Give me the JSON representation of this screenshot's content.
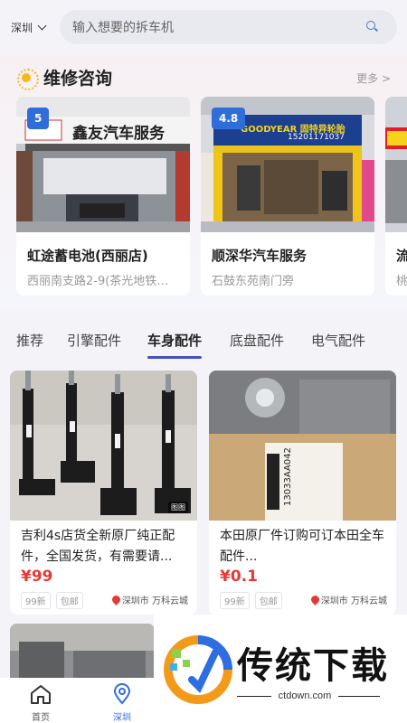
{
  "header": {
    "city": "深圳",
    "search_placeholder": "输入想要的拆车机"
  },
  "repair": {
    "title": "维修咨询",
    "more": "更多 >",
    "shops": [
      {
        "rating": "5",
        "name": "虹途蓄电池(西丽店)",
        "address": "西丽南支路2-9(茶光地铁…",
        "sign": "鑫友汽车服务"
      },
      {
        "rating": "4.8",
        "name": "顺深华汽车服务",
        "address": "石鼓东苑南门旁",
        "sign": "GOODYEAR 固特异轮胎",
        "phone": "15201171037"
      },
      {
        "rating": "",
        "name": "流",
        "address": "桃"
      }
    ]
  },
  "tabs": [
    "推荐",
    "引擎配件",
    "车身配件",
    "底盘配件",
    "电气配件"
  ],
  "active_tab": "车身配件",
  "products": [
    {
      "title": "吉利4s店货全新原厂纯正配件，全国发货，有需要请...",
      "price": "¥99",
      "tags": [
        "99新",
        "包邮"
      ],
      "location": "深圳市 万科云城",
      "image_badge": "图图"
    },
    {
      "title": "本田原厂件订购可订本田全车配件...",
      "price": "¥0.1",
      "tags": [
        "99新",
        "包邮"
      ],
      "location": "深圳市 万科云城",
      "box_label": "13033AA042"
    }
  ],
  "bottom_nav": [
    {
      "label": "首页",
      "icon": "home-icon"
    },
    {
      "label": "深圳",
      "icon": "location-icon"
    }
  ],
  "watermark": {
    "text": "传统下载",
    "url": "ctdown.com"
  },
  "colors": {
    "accent": "#4a4fb8",
    "price": "#e53935",
    "rating": "#2f6dd8"
  }
}
